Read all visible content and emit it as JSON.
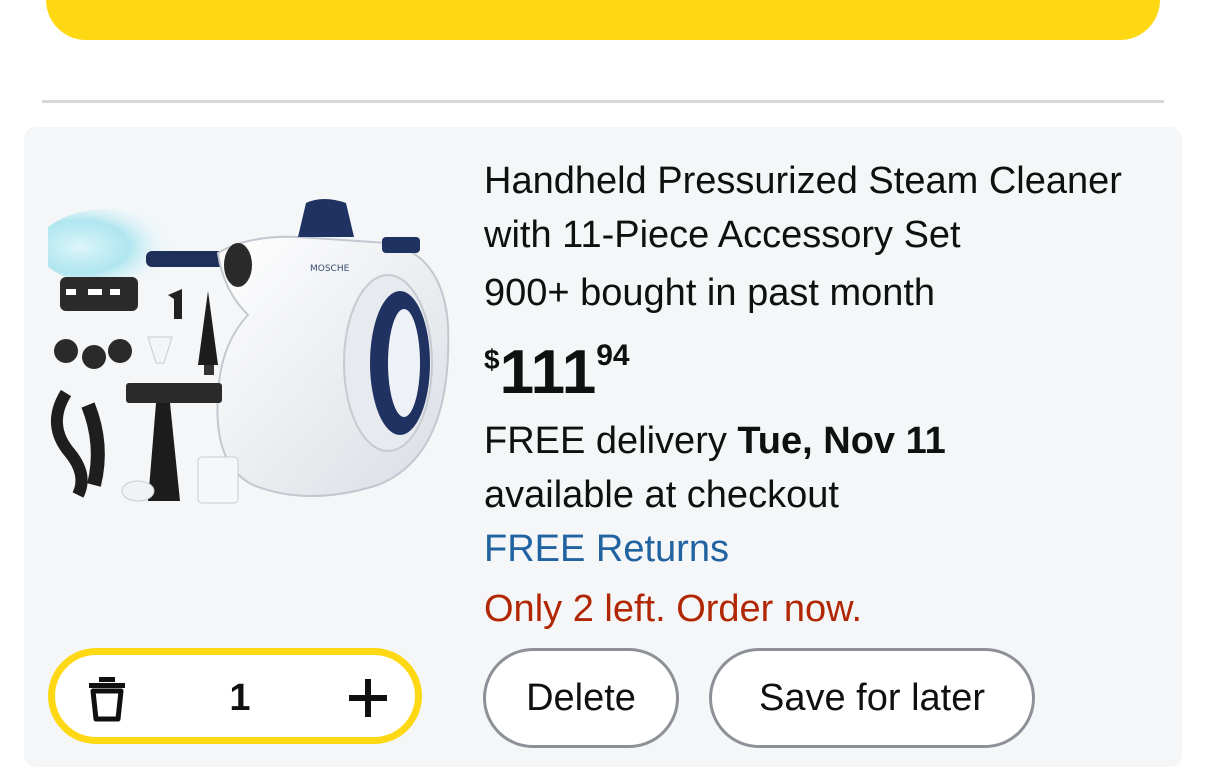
{
  "cart_item": {
    "title": "Handheld Pressurized Steam Cleaner with 11-Piece Accessory Set",
    "image_brand": "MOSCHE",
    "social_proof": "900+ bought in past month",
    "price": {
      "symbol": "$",
      "whole": "111",
      "fraction": "94"
    },
    "delivery": {
      "prefix": "FREE delivery ",
      "date": "Tue, Nov 11"
    },
    "availability_note": "available at checkout",
    "returns_link": "FREE Returns",
    "stock_warning": "Only 2 left. Order now.",
    "quantity": "1",
    "delete_label": "Delete",
    "save_label": "Save for later"
  },
  "icons": {
    "remove": "trash-icon",
    "add": "plus-icon"
  },
  "colors": {
    "primary_button": "#ffd814",
    "card_background": "#f4f6f8",
    "link": "#2162a1",
    "stock_warning": "#b12704",
    "text": "#0f1111"
  }
}
